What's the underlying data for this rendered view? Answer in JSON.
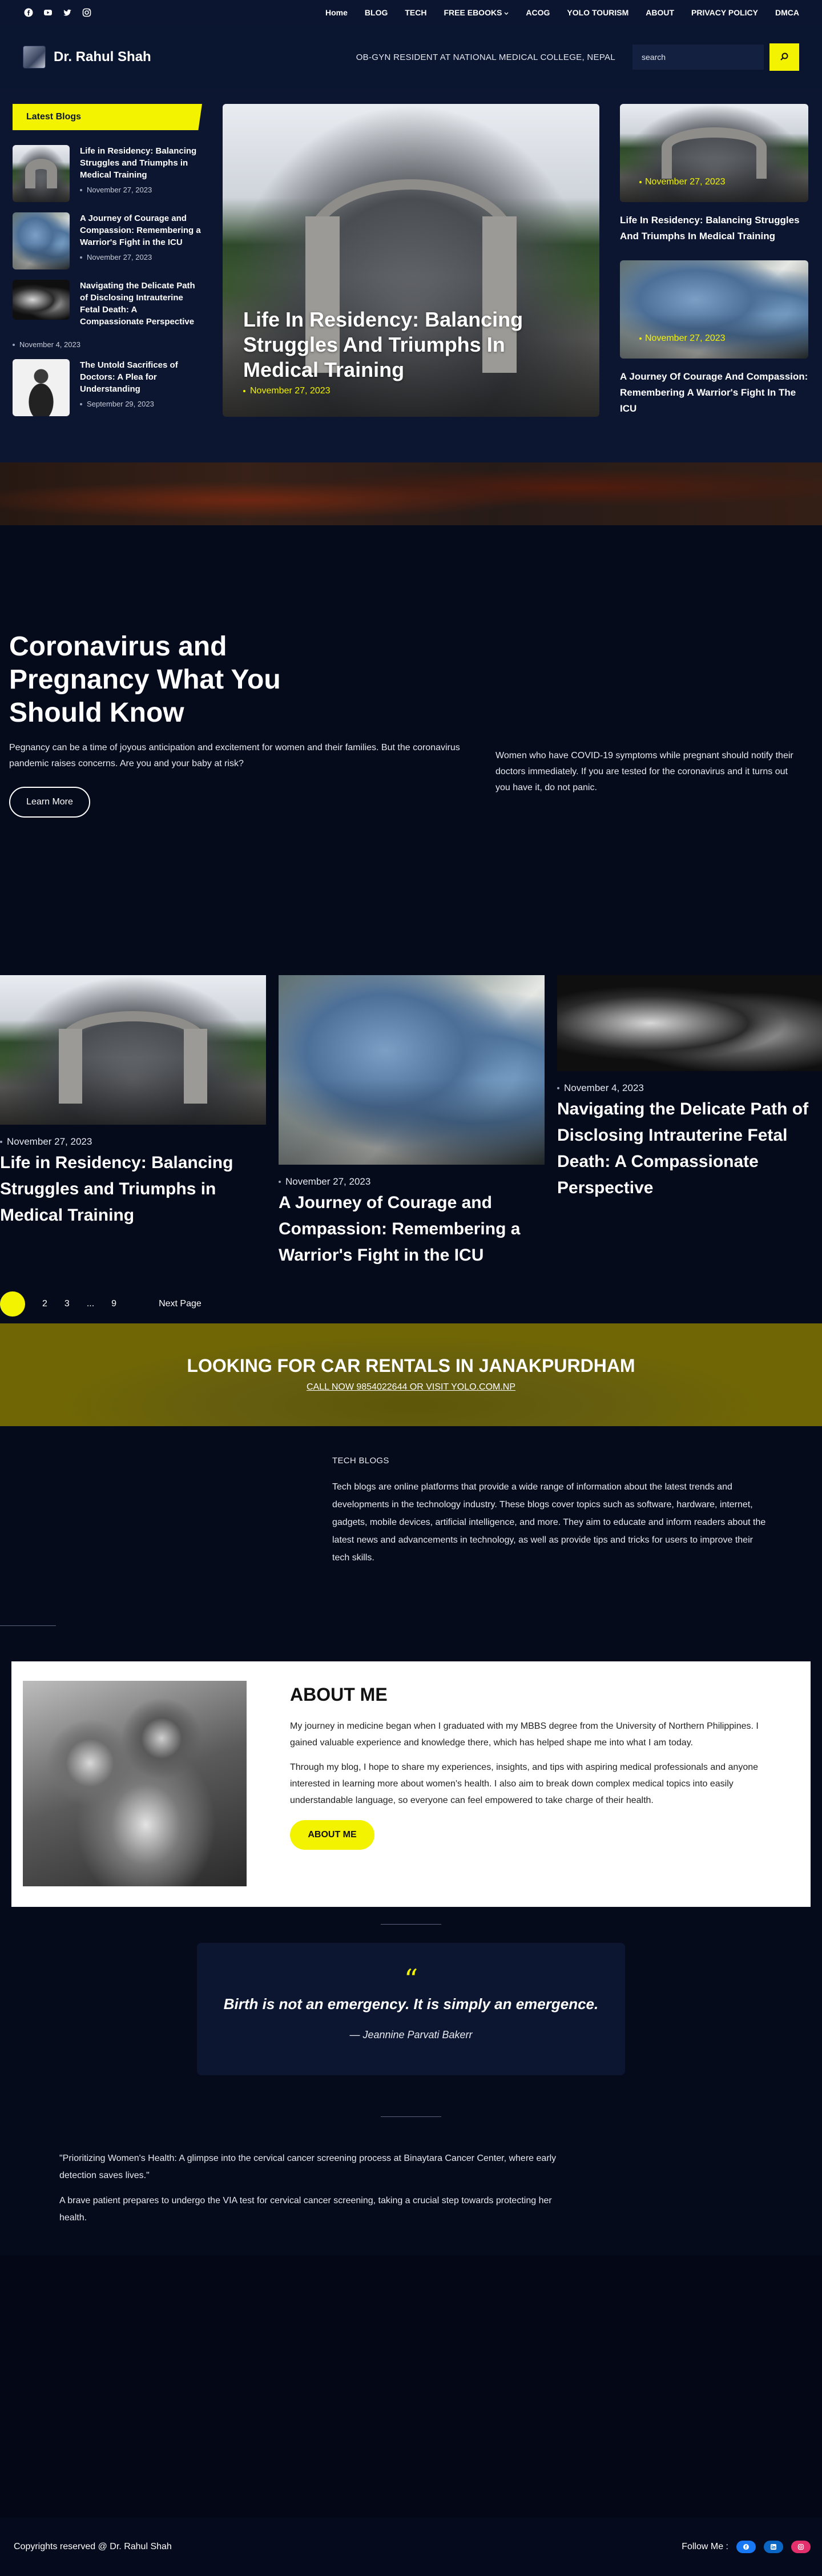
{
  "topbar": {
    "social_icons": [
      "facebook-icon",
      "youtube-icon",
      "twitter-icon",
      "instagram-icon"
    ],
    "nav": [
      "Home",
      "BLOG",
      "TECH",
      "FREE EBOOKS",
      "ACOG",
      "YOLO TOURISM",
      "ABOUT",
      "PRIVACY POLICY",
      "DMCA"
    ]
  },
  "header": {
    "site_name": "Dr. Rahul Shah",
    "tagline": "OB-GYN RESIDENT AT NATIONAL MEDICAL COLLEGE, NEPAL",
    "search_placeholder": "search"
  },
  "latest": {
    "label": "Latest Blogs",
    "items": [
      {
        "title": "Life in Residency: Balancing Struggles and Triumphs in Medical Training",
        "date": "November 27, 2023"
      },
      {
        "title": "A Journey of Courage and Compassion: Remembering a Warrior's Fight in the ICU",
        "date": "November 27, 2023"
      },
      {
        "title": "Navigating the Delicate Path of Disclosing Intrauterine Fetal Death: A Compassionate Perspective",
        "date": "November 4, 2023"
      },
      {
        "title": "The Untold Sacrifices of Doctors: A Plea for Understanding",
        "date": "September 29, 2023"
      }
    ]
  },
  "featured": {
    "main": {
      "title": "Life In Residency: Balancing Struggles And Triumphs In Medical Training",
      "date": "November 27, 2023"
    },
    "side": [
      {
        "title": "Life In Residency: Balancing Struggles And Triumphs In Medical Training",
        "date": "November 27, 2023"
      },
      {
        "title": "A Journey Of Courage And Compassion: Remembering A Warrior's Fight In The ICU",
        "date": "November 27, 2023"
      }
    ]
  },
  "hero": {
    "title": "Coronavirus and Pregnancy What You Should Know",
    "left_text": "Pegnancy can be a time of joyous anticipation and excitement for women and their families. But the coronavirus pandemic raises concerns. Are you and your baby at risk?",
    "right_text": "Women who have COVID-19 symptoms while pregnant should notify their doctors immediately. If you are tested for the coronavirus and it turns out you have it, do not panic.",
    "button": "Learn More"
  },
  "posts": [
    {
      "date": "November 27, 2023",
      "title": "Life in Residency: Balancing Struggles and Triumphs in Medical Training"
    },
    {
      "date": "November 27, 2023",
      "title": "A Journey of Courage and Compassion: Remembering a Warrior's Fight in the ICU"
    },
    {
      "date": "November 4, 2023",
      "title": "Navigating the Delicate Path of Disclosing Intrauterine Fetal Death: A Compassionate Perspective"
    }
  ],
  "pagination": {
    "current": "1",
    "pages": [
      "2",
      "3",
      "...",
      "9"
    ],
    "next": "Next Page"
  },
  "rentals": {
    "title": "LOOKING FOR CAR RENTALS IN JANAKPURDHAM",
    "cta": "CALL NOW 9854022644 OR VISIT YOLO.COM.NP"
  },
  "tech": {
    "heading": "TECH BLOGS",
    "text": "Tech blogs are online platforms that provide a wide range of information about the latest trends and developments in the technology industry. These blogs cover topics such as software, hardware, internet, gadgets, mobile devices, artificial intelligence, and more. They aim to educate and inform readers about the latest news and advancements in technology, as well as provide tips and tricks for users to improve their tech skills."
  },
  "about": {
    "title": "ABOUT ME",
    "p1": "My journey in medicine began when I graduated with my MBBS degree from the University of Northern Philippines. I gained valuable experience and knowledge there, which has helped shape me into what I am today.",
    "p2": "Through my blog, I hope to share my experiences, insights, and tips with aspiring medical professionals and anyone interested in learning more about women's health. I also aim to break down complex medical topics into easily understandable language, so everyone can feel empowered to take charge of their health.",
    "button": "ABOUT ME"
  },
  "quote": {
    "mark": "“",
    "text": "Birth is not an emergency. It is simply an emergence.",
    "author": "— Jeannine Parvati Bakerr"
  },
  "cervical": {
    "p1": "\"Prioritizing Women's Health: A glimpse into the cervical cancer screening process at Binaytara Cancer Center, where early detection saves lives.\"",
    "p2": "A brave patient prepares to undergo the VIA test for cervical cancer screening, taking a crucial step towards protecting her health."
  },
  "footer": {
    "copyright": "Copyrights reserved @ Dr. Rahul Shah",
    "follow_label": "Follow Me :",
    "follow_icons": [
      "facebook-icon",
      "linkedin-icon",
      "instagram-icon"
    ],
    "colors": {
      "facebook": "#1877f2",
      "linkedin": "#0a66c2",
      "instagram": "#e1306c"
    }
  },
  "colors": {
    "accent": "#f3f300",
    "bg": "#060b1c",
    "panel": "#0c1631"
  }
}
